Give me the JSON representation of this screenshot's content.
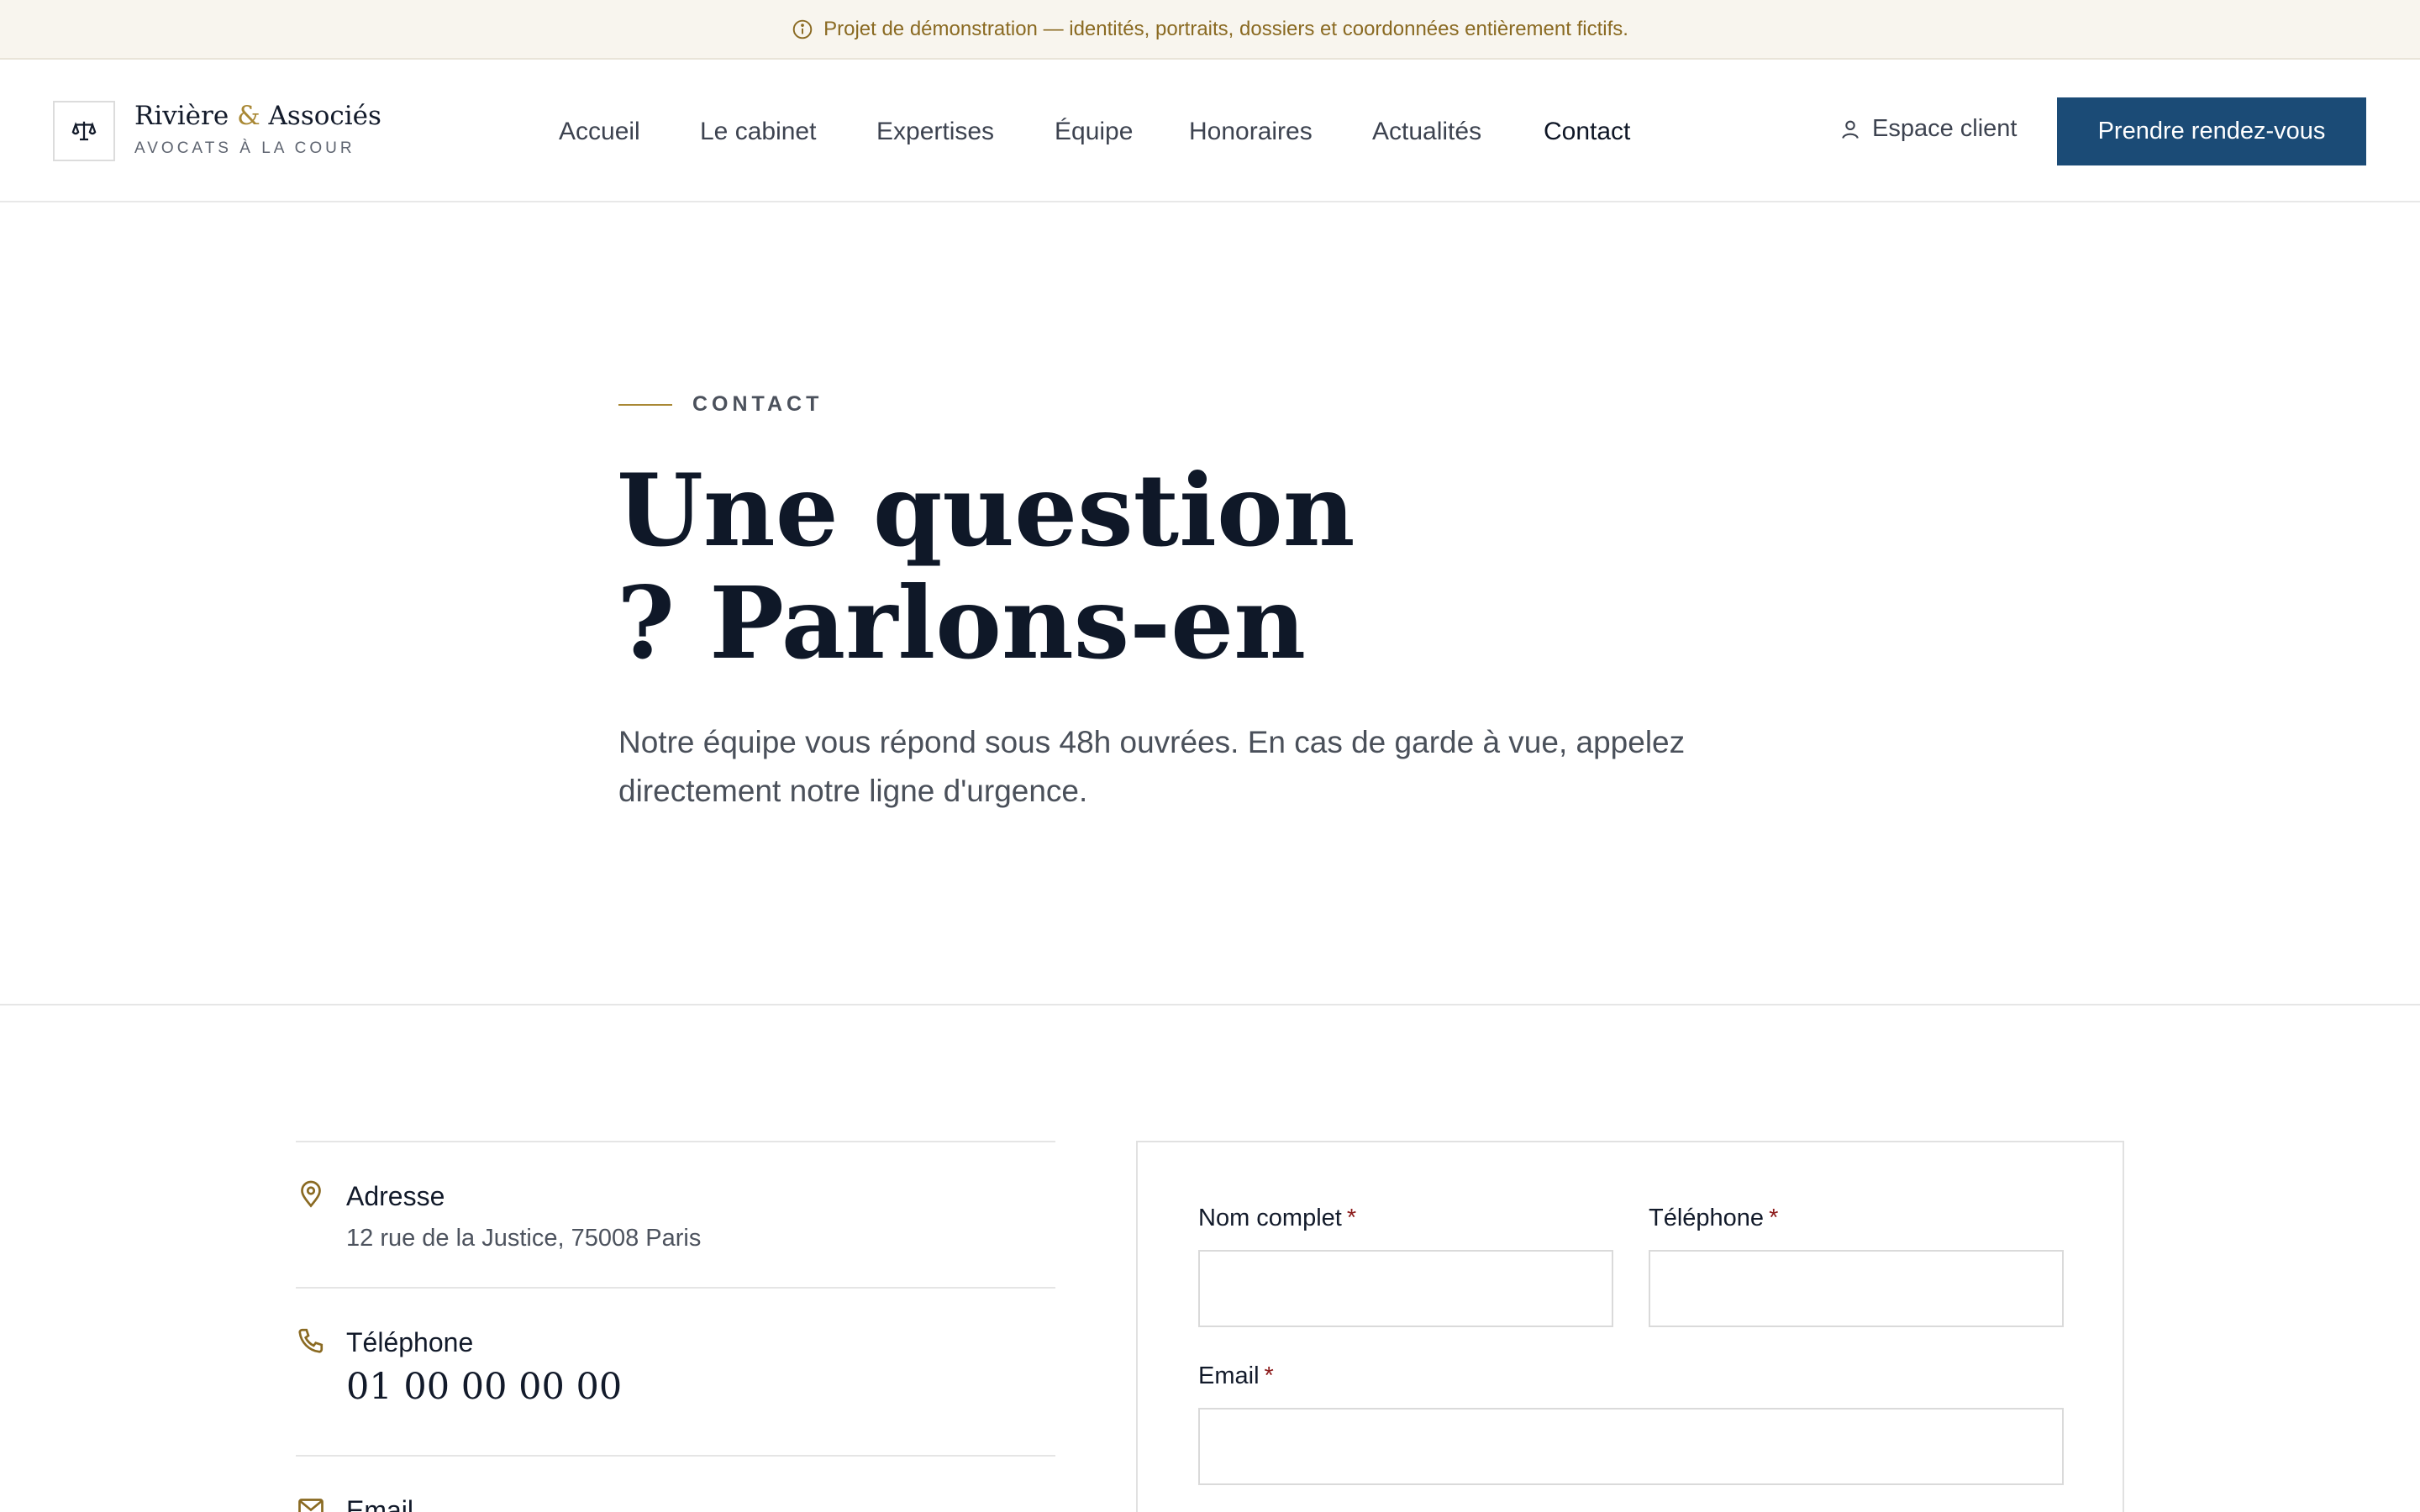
{
  "banner": {
    "text": "Projet de démonstration — identités, portraits, dossiers et coordonnées entièrement fictifs.",
    "icon": "info-circle-icon"
  },
  "header": {
    "brand_name_a": "Rivière",
    "brand_amp": "&",
    "brand_name_b": "Associés",
    "brand_sub": "AVOCATS À LA COUR",
    "logo_icon": "scales-icon",
    "nav": [
      "Accueil",
      "Le cabinet",
      "Expertises",
      "Équipe",
      "Honoraires",
      "Actualités",
      "Contact"
    ],
    "active_nav": "Contact",
    "client_label": "Espace client",
    "client_icon": "user-icon",
    "cta_label": "Prendre rendez-vous"
  },
  "hero": {
    "eyebrow": "CONTACT",
    "title_line1": "Une question",
    "title_line2": "? Parlons-en",
    "lead": "Notre équipe vous répond sous 48h ouvrées. En cas de garde à vue, appelez directement notre ligne d'urgence."
  },
  "contact_info": {
    "address_label": "Adresse",
    "address_value": "12 rue de la Justice, 75008 Paris",
    "phone_label": "Téléphone",
    "phone_value": "01 00 00 00 00",
    "email_label": "Email"
  },
  "form": {
    "name_label": "Nom complet",
    "phone_label": "Téléphone",
    "email_label": "Email",
    "required_mark": "*",
    "name_value": "",
    "phone_value": "",
    "email_value": ""
  },
  "colors": {
    "accent_gold": "#a98834",
    "primary_blue": "#1b4b76",
    "required_red": "#8c1b1b",
    "banner_bg": "#f8f5ee"
  }
}
